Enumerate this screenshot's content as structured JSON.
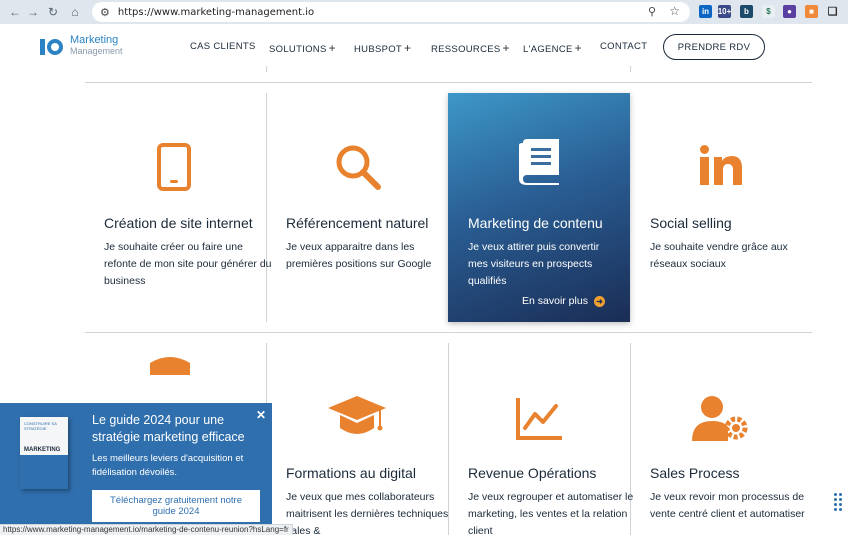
{
  "browser": {
    "url": "https://www.marketing-management.io",
    "status_url": "https://www.marketing-management.io/marketing-de-contenu-reunion?hsLang=fr"
  },
  "header": {
    "logo_line1": "Marketing",
    "logo_line2": "Management",
    "menu": [
      {
        "label": "CAS CLIENTS",
        "has_submenu": false
      },
      {
        "label": "SOLUTIONS",
        "has_submenu": true
      },
      {
        "label": "HUBSPOT",
        "has_submenu": true
      },
      {
        "label": "RESSOURCES",
        "has_submenu": true
      },
      {
        "label": "L'AGENCE",
        "has_submenu": true
      },
      {
        "label": "CONTACT",
        "has_submenu": false
      }
    ],
    "cta_label": "PRENDRE RDV"
  },
  "services": [
    {
      "icon": "smartphone-icon",
      "title": "Création de site internet",
      "desc": "Je souhaite créer ou faire une refonte de mon site pour générer du business"
    },
    {
      "icon": "search-icon",
      "title": "Référencement naturel",
      "desc": "Je veux apparaitre dans les premières positions sur Google"
    },
    {
      "icon": "book-icon",
      "title": "Marketing de contenu",
      "desc": "Je veux attirer puis convertir mes visiteurs en prospects qualifiés",
      "link": "En savoir plus"
    },
    {
      "icon": "linkedin-icon",
      "title": "Social selling",
      "desc": "Je souhaite vendre grâce aux réseaux sociaux"
    },
    {
      "icon": "graduation-cap-icon",
      "title": "Formations au digital",
      "desc": "Je veux que mes collaborateurs maitrisent les dernières techniques sales &"
    },
    {
      "icon": "chart-icon",
      "title": "Revenue Opérations",
      "desc": "Je veux regrouper et automatiser le marketing, les ventes et la relation client"
    },
    {
      "icon": "user-gear-icon",
      "title": "Sales Process",
      "desc": "Je veux revoir mon processus de vente centré client et automatiser"
    }
  ],
  "popup": {
    "title": "Le guide 2024 pour une stratégie marketing efficace",
    "text": "Les meilleurs leviers d'acquisition et fidélisation dévoilés.",
    "button": "Téléchargez gratuitement notre guide 2024",
    "book_cover_top": "CONSTRUIRE SA STRATÉGIE",
    "book_cover_title": "MARKETING"
  },
  "colors": {
    "accent": "#e8822e",
    "navy": "#1b2a3a",
    "popup_blue": "#2f6fae"
  }
}
